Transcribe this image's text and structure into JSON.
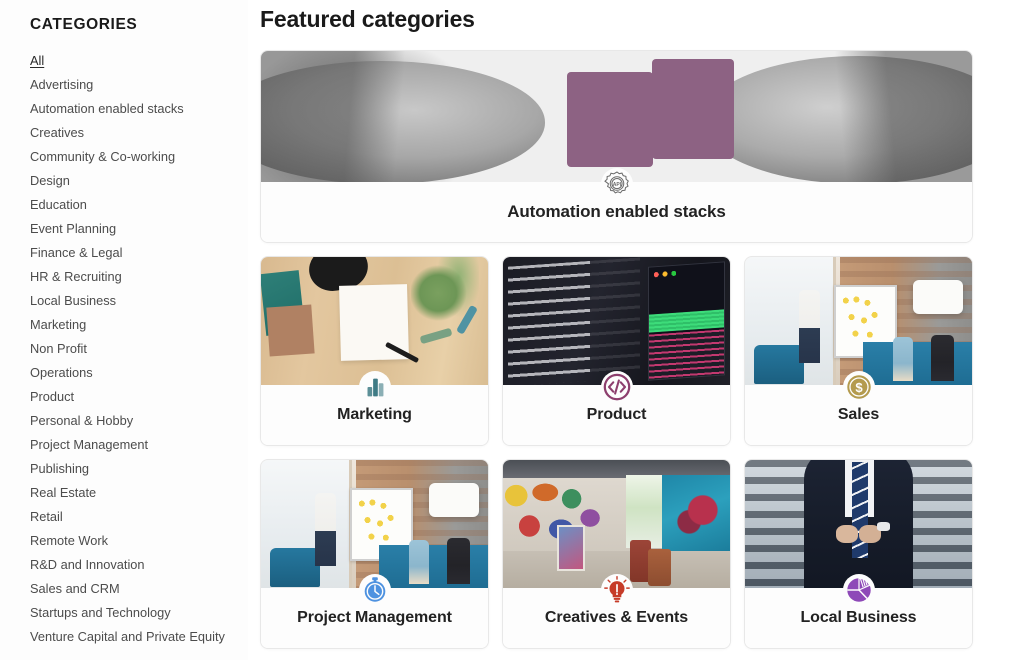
{
  "sidebar": {
    "title": "CATEGORIES",
    "items": [
      {
        "label": "All",
        "active": true
      },
      {
        "label": "Advertising",
        "active": false
      },
      {
        "label": "Automation enabled stacks",
        "active": false
      },
      {
        "label": "Creatives",
        "active": false
      },
      {
        "label": "Community & Co-working",
        "active": false
      },
      {
        "label": "Design",
        "active": false
      },
      {
        "label": "Education",
        "active": false
      },
      {
        "label": "Event Planning",
        "active": false
      },
      {
        "label": "Finance & Legal",
        "active": false
      },
      {
        "label": "HR & Recruiting",
        "active": false
      },
      {
        "label": "Local Business",
        "active": false
      },
      {
        "label": "Marketing",
        "active": false
      },
      {
        "label": "Non Profit",
        "active": false
      },
      {
        "label": "Operations",
        "active": false
      },
      {
        "label": "Product",
        "active": false
      },
      {
        "label": "Personal & Hobby",
        "active": false
      },
      {
        "label": "Project Management",
        "active": false
      },
      {
        "label": "Publishing",
        "active": false
      },
      {
        "label": "Real Estate",
        "active": false
      },
      {
        "label": "Retail",
        "active": false
      },
      {
        "label": "Remote Work",
        "active": false
      },
      {
        "label": "R&D and Innovation",
        "active": false
      },
      {
        "label": "Sales and CRM",
        "active": false
      },
      {
        "label": "Startups and Technology",
        "active": false
      },
      {
        "label": "Venture Capital and Private Equity",
        "active": false
      }
    ]
  },
  "main": {
    "page_title": "Featured categories",
    "hero": {
      "label": "Automation enabled stacks",
      "badge_icon": "api-gear-icon",
      "badge_text": "API",
      "badge_color": "#6b6b6b",
      "image_alt": "two hands joining purple jigsaw puzzle pieces",
      "image_style": "puzzle"
    },
    "cards": [
      {
        "label": "Marketing",
        "badge_icon": "bar-chart-icon",
        "badge_color": "#3f7b85",
        "image_alt": "wooden desk flat-lay with marketing strategy note, books and plant",
        "image_style": "desk"
      },
      {
        "label": "Product",
        "badge_icon": "code-tag-icon",
        "badge_color": "#8d3f6e",
        "image_alt": "dark terminal screen with build output and code",
        "image_style": "code"
      },
      {
        "label": "Sales",
        "badge_icon": "dollar-coin-icon",
        "badge_color": "#b49b4e",
        "image_alt": "team meeting in loft office around a whiteboard",
        "image_style": "office"
      },
      {
        "label": "Project Management",
        "badge_icon": "stopwatch-icon",
        "badge_color": "#4e92e0",
        "image_alt": "team meeting in loft office with laptops",
        "image_style": "office"
      },
      {
        "label": "Creatives & Events",
        "badge_icon": "lightbulb-icon",
        "badge_color": "#c63b28",
        "image_alt": "graffiti covered art studio with canvases",
        "image_style": "graffiti"
      },
      {
        "label": "Local Business",
        "badge_icon": "pie-segments-icon",
        "badge_color": "#8e49b8",
        "image_alt": "businessman in suit buttoning jacket on stairs",
        "image_style": "suit"
      }
    ]
  }
}
